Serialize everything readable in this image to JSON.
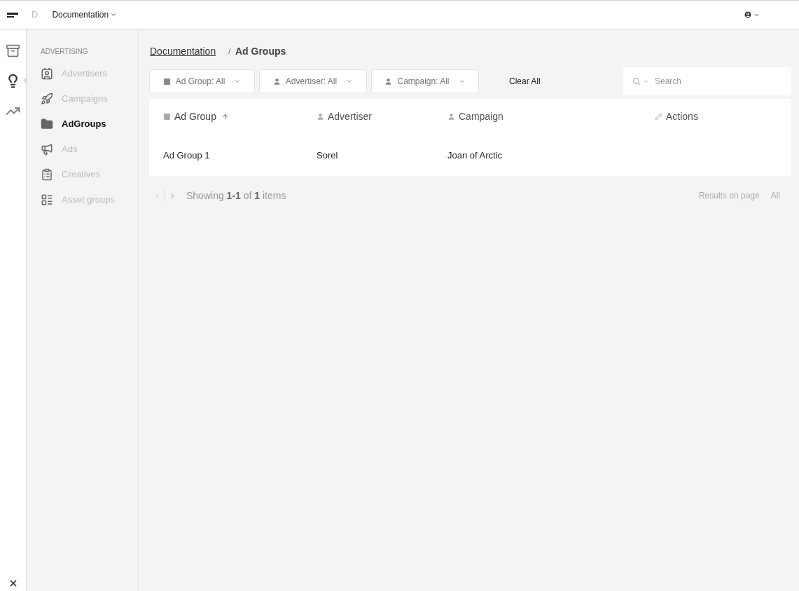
{
  "topbar": {
    "logo_letter": "D",
    "workspace": "Documentation"
  },
  "rail": [
    {
      "selected": false
    },
    {
      "selected": true
    },
    {
      "selected": false
    }
  ],
  "sidebar": {
    "section": "ADVERTISING",
    "items": [
      {
        "label": "Advertisers",
        "selected": false
      },
      {
        "label": "Campaigns",
        "selected": false
      },
      {
        "label": "AdGroups",
        "selected": true
      },
      {
        "label": "Ads",
        "selected": false
      },
      {
        "label": "Creatives",
        "selected": false
      },
      {
        "label": "Asset groups",
        "selected": false
      }
    ]
  },
  "breadcrumb": {
    "link": "Documentation",
    "separator": "/",
    "current": "Ad Groups"
  },
  "filters": [
    "Ad Group: All",
    "Advertiser: All",
    "Campaign: All"
  ],
  "clear": "Clear All",
  "search": {
    "placeholder": "Search"
  },
  "table": {
    "columns": [
      {
        "label": "Ad Group",
        "sorted": true
      },
      {
        "label": "Advertiser",
        "sorted": false
      },
      {
        "label": "Campaign",
        "sorted": false
      },
      {
        "label": "Actions",
        "sorted": false
      }
    ],
    "rows": [
      [
        "Ad Group 1",
        "Sorel",
        "Joan of Arctic"
      ]
    ]
  },
  "pagination": {
    "showing": "Showing **1-1** of **1** items",
    "results_label": "Results on page",
    "results_value": "All"
  }
}
